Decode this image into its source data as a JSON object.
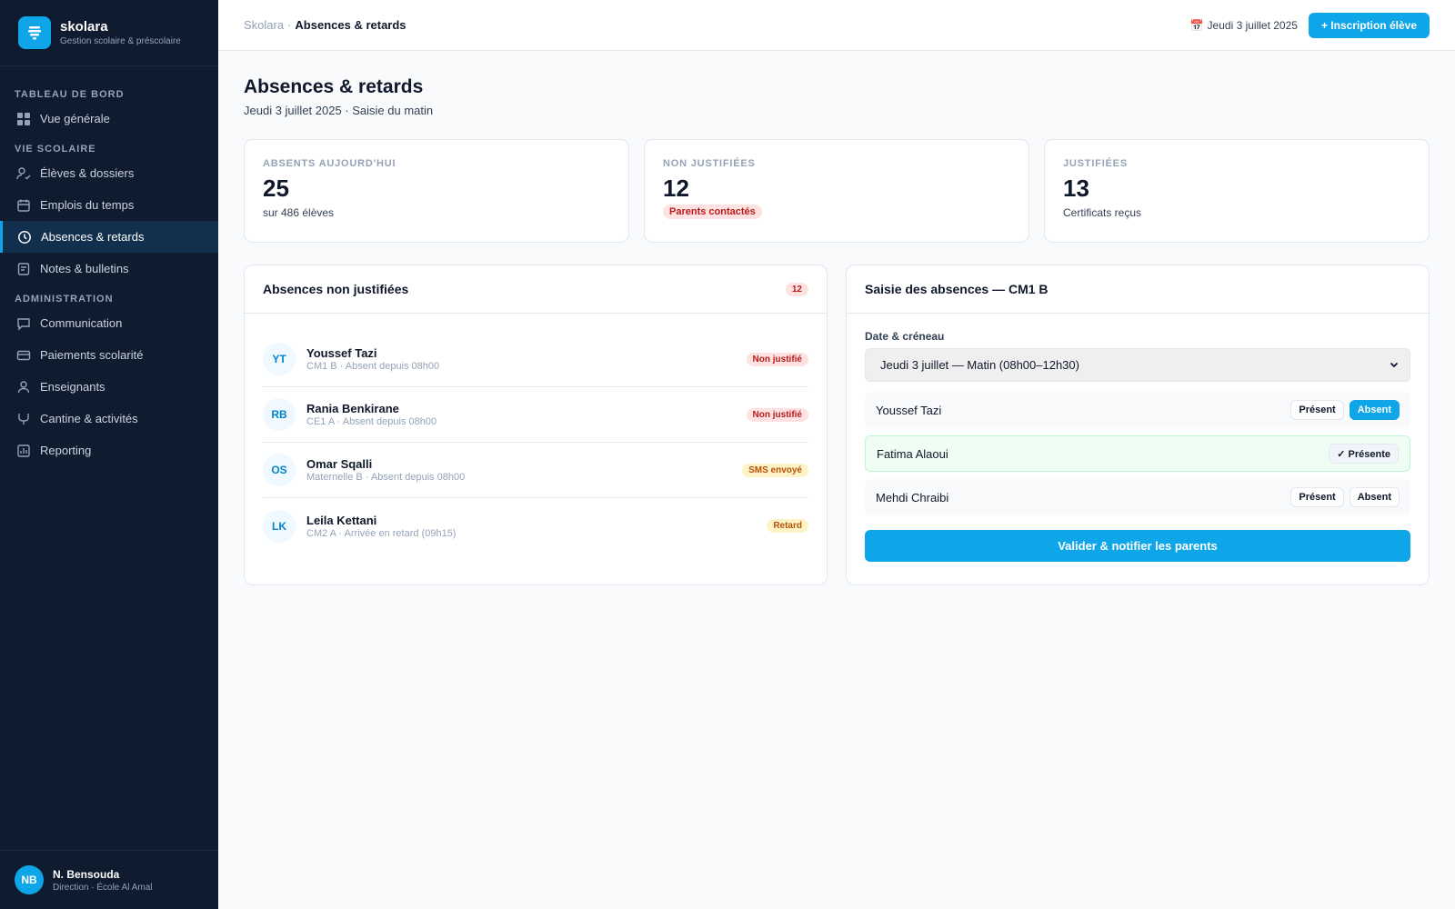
{
  "brand": {
    "name": "skolara",
    "tagline": "Gestion scolaire & préscolaire",
    "logo_icon": "school-icon"
  },
  "sidebar": {
    "sections": [
      {
        "title": "TABLEAU DE BORD",
        "items": [
          {
            "label": "Vue générale",
            "icon": "grid-icon",
            "active": false
          }
        ]
      },
      {
        "title": "VIE SCOLAIRE",
        "items": [
          {
            "label": "Élèves & dossiers",
            "icon": "user-check-icon",
            "active": false
          },
          {
            "label": "Emplois du temps",
            "icon": "calendar-icon",
            "active": false
          },
          {
            "label": "Absences & retards",
            "icon": "clock-icon",
            "active": true
          },
          {
            "label": "Notes & bulletins",
            "icon": "document-icon",
            "active": false
          }
        ]
      },
      {
        "title": "ADMINISTRATION",
        "items": [
          {
            "label": "Communication",
            "icon": "chat-icon",
            "active": false
          },
          {
            "label": "Paiements scolarité",
            "icon": "credit-card-icon",
            "active": false
          },
          {
            "label": "Enseignants",
            "icon": "user-icon",
            "active": false
          },
          {
            "label": "Cantine & activités",
            "icon": "utensils-icon",
            "active": false
          },
          {
            "label": "Reporting",
            "icon": "chart-icon",
            "active": false
          }
        ]
      }
    ]
  },
  "user": {
    "initials": "NB",
    "name": "N. Bensouda",
    "role": "Direction · École Al Amal"
  },
  "topbar": {
    "breadcrumb_root": "Skolara",
    "breadcrumb_sep": "·",
    "breadcrumb_current": "Absences & retards",
    "date": "Jeudi 3 juillet 2025",
    "date_icon": "calendar-icon",
    "cta_label": "+ Inscription élève"
  },
  "page": {
    "title": "Absences & retards",
    "subtitle": "Jeudi 3 juillet 2025 · Saisie du matin"
  },
  "stats": [
    {
      "label": "ABSENTS AUJOURD'HUI",
      "value": "25",
      "note": "sur 486 élèves"
    },
    {
      "label": "NON JUSTIFIÉES",
      "value": "12",
      "badge": "Parents contactés"
    },
    {
      "label": "JUSTIFIÉES",
      "value": "13",
      "note": "Certificats reçus"
    }
  ],
  "absences_panel": {
    "title": "Absences non justifiées",
    "count": "12",
    "rows": [
      {
        "initials": "YT",
        "name": "Youssef Tazi",
        "meta": "CM1 B · Absent depuis 08h00",
        "tag": "Non justifié",
        "tag_color": "#b91c1c"
      },
      {
        "initials": "RB",
        "name": "Rania Benkirane",
        "meta": "CE1 A · Absent depuis 08h00",
        "tag": "Non justifié",
        "tag_color": "#b91c1c"
      },
      {
        "initials": "OS",
        "name": "Omar Sqalli",
        "meta": "Maternelle B · Absent depuis 08h00",
        "tag": "SMS envoyé",
        "tag_color": "#b45309"
      },
      {
        "initials": "LK",
        "name": "Leila Kettani",
        "meta": "CM2 A · Arrivée en retard (09h15)",
        "tag": "Retard",
        "tag_color": "#b45309"
      }
    ]
  },
  "entry_panel": {
    "title": "Saisie des absences — CM1 B",
    "date_label": "Date & créneau",
    "date_value": "Jeudi 3 juillet — Matin (08h00–12h30)",
    "students": [
      {
        "name": "Youssef Tazi",
        "present_label": "Présent",
        "absent_label": "Absent",
        "state": "absent"
      },
      {
        "name": "Fatima Alaoui",
        "present_label": "✓ Présente",
        "state": "present"
      },
      {
        "name": "Mehdi Chraibi",
        "present_label": "Présent",
        "absent_label": "Absent",
        "state": "none"
      }
    ],
    "submit_label": "Valider & notifier les parents"
  },
  "colors": {
    "accent": "#0ea5e9",
    "sidebar_bg": "#0f1b2e",
    "danger": "#b91c1c",
    "warning": "#b45309"
  }
}
